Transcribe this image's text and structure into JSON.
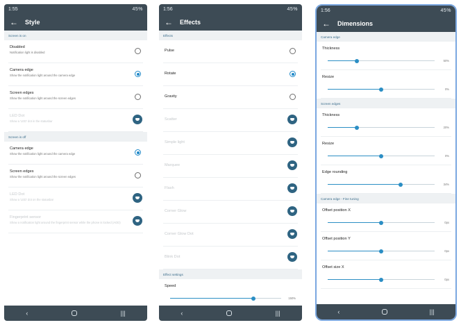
{
  "accent": "#1e88c8",
  "bar_color": "#3d4b55",
  "phone1": {
    "status": {
      "time": "1:55",
      "battery": "45%"
    },
    "title": "Style",
    "sections": [
      {
        "header": "Screen is on",
        "items": [
          {
            "label": "Disabled",
            "desc": "Notification light is disabled",
            "control": "radio",
            "checked": false
          },
          {
            "label": "Camera edge",
            "desc": "Show the notification light around the camera edge",
            "control": "radio",
            "checked": true
          },
          {
            "label": "Screen edges",
            "desc": "Show the notification light around the screen edges",
            "control": "radio",
            "checked": false
          },
          {
            "label": "LED Dot",
            "desc": "Show a 'LED' dot in the statusbar",
            "control": "pro",
            "disabled": true
          }
        ]
      },
      {
        "header": "Screen is off",
        "items": [
          {
            "label": "Camera edge",
            "desc": "Show the notification light around the camera edge",
            "control": "radio",
            "checked": true
          },
          {
            "label": "Screen edges",
            "desc": "Show the notification light around the screen edges",
            "control": "radio",
            "checked": false
          },
          {
            "label": "LED Dot",
            "desc": "Show a 'LED' dot on the statusbar",
            "control": "pro",
            "disabled": true
          },
          {
            "label": "Fingerprint sensor",
            "desc": "Show a notification light around the fingerprint sensor while the phone is locked (AOD)",
            "control": "pro",
            "disabled": true
          }
        ]
      }
    ]
  },
  "phone2": {
    "status": {
      "time": "1:56",
      "battery": "45%"
    },
    "title": "Effects",
    "header": "Effects",
    "items": [
      {
        "label": "Pulse",
        "control": "radio",
        "checked": false
      },
      {
        "label": "Rotate",
        "control": "radio",
        "checked": true
      },
      {
        "label": "Gravity",
        "control": "radio",
        "checked": false
      },
      {
        "label": "Scatter",
        "control": "pro",
        "disabled": true
      },
      {
        "label": "Simple light",
        "control": "pro",
        "disabled": true
      },
      {
        "label": "Marquee",
        "control": "pro",
        "disabled": true
      },
      {
        "label": "Flash",
        "control": "pro",
        "disabled": true
      },
      {
        "label": "Corner Glow",
        "control": "pro",
        "disabled": true
      },
      {
        "label": "Corner Glow Dot",
        "control": "pro",
        "disabled": true
      },
      {
        "label": "Blink Dot",
        "control": "pro",
        "disabled": true
      }
    ],
    "settings_header": "Effect settings",
    "speed": {
      "label": "Speed",
      "value_text": "150%",
      "fraction": 0.75
    }
  },
  "phone3": {
    "status": {
      "time": "1:56",
      "battery": "45%"
    },
    "title": "Dimensions",
    "sections": [
      {
        "header": "Camera edge",
        "sliders": [
          {
            "label": "Thickness",
            "value_text": "50%",
            "fraction": 0.27
          },
          {
            "label": "Resize",
            "value_text": "0%",
            "fraction": 0.5
          }
        ]
      },
      {
        "header": "Screen edges",
        "sliders": [
          {
            "label": "Thickness",
            "value_text": "20%",
            "fraction": 0.27
          },
          {
            "label": "Resize",
            "value_text": "0%",
            "fraction": 0.5
          },
          {
            "label": "Edge rounding",
            "value_text": "34%",
            "fraction": 0.68
          }
        ]
      },
      {
        "header": "Camera edge - Fine tuning",
        "sliders": [
          {
            "label": "Offset position X",
            "value_text": "0px",
            "fraction": 0.5
          },
          {
            "label": "Offset position Y",
            "value_text": "0px",
            "fraction": 0.5
          },
          {
            "label": "Offset size X",
            "value_text": "0px",
            "fraction": 0.5
          }
        ]
      }
    ]
  },
  "nav": {
    "back": "‹",
    "recents": "|||"
  }
}
